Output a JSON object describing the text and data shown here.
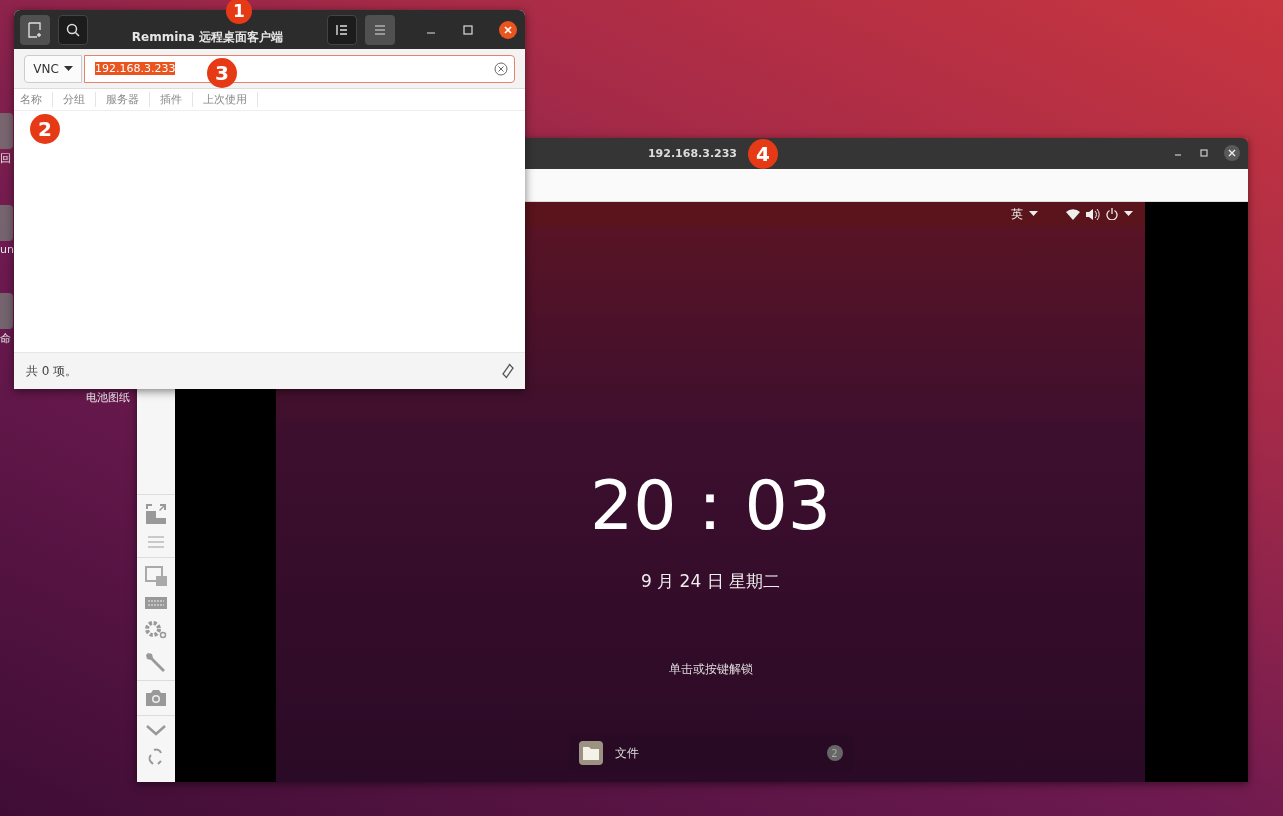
{
  "desktop": {
    "icons": [
      {
        "label": "回"
      },
      {
        "label": "un"
      },
      {
        "label": "命"
      },
      {
        "label": "电池图纸"
      }
    ]
  },
  "remmina_window": {
    "title": "Remmina 远程桌面客户端",
    "protocol": "VNC",
    "address": {
      "value": "192.168.3.233",
      "selected": true
    },
    "columns": [
      {
        "label": "名称"
      },
      {
        "label": "分组"
      },
      {
        "label": "服务器"
      },
      {
        "label": "插件"
      },
      {
        "label": "上次使用"
      }
    ],
    "status": "共 0 项。"
  },
  "remote_window": {
    "title": "192.168.3.233",
    "input_method": "英",
    "clock": "20：03",
    "date": "9 月 24 日 星期二",
    "hint": "单击或按键解锁",
    "notification": {
      "app": "文件",
      "count": "2"
    }
  },
  "callouts": [
    {
      "number": "1"
    },
    {
      "number": "2"
    },
    {
      "number": "3"
    },
    {
      "number": "4"
    }
  ]
}
